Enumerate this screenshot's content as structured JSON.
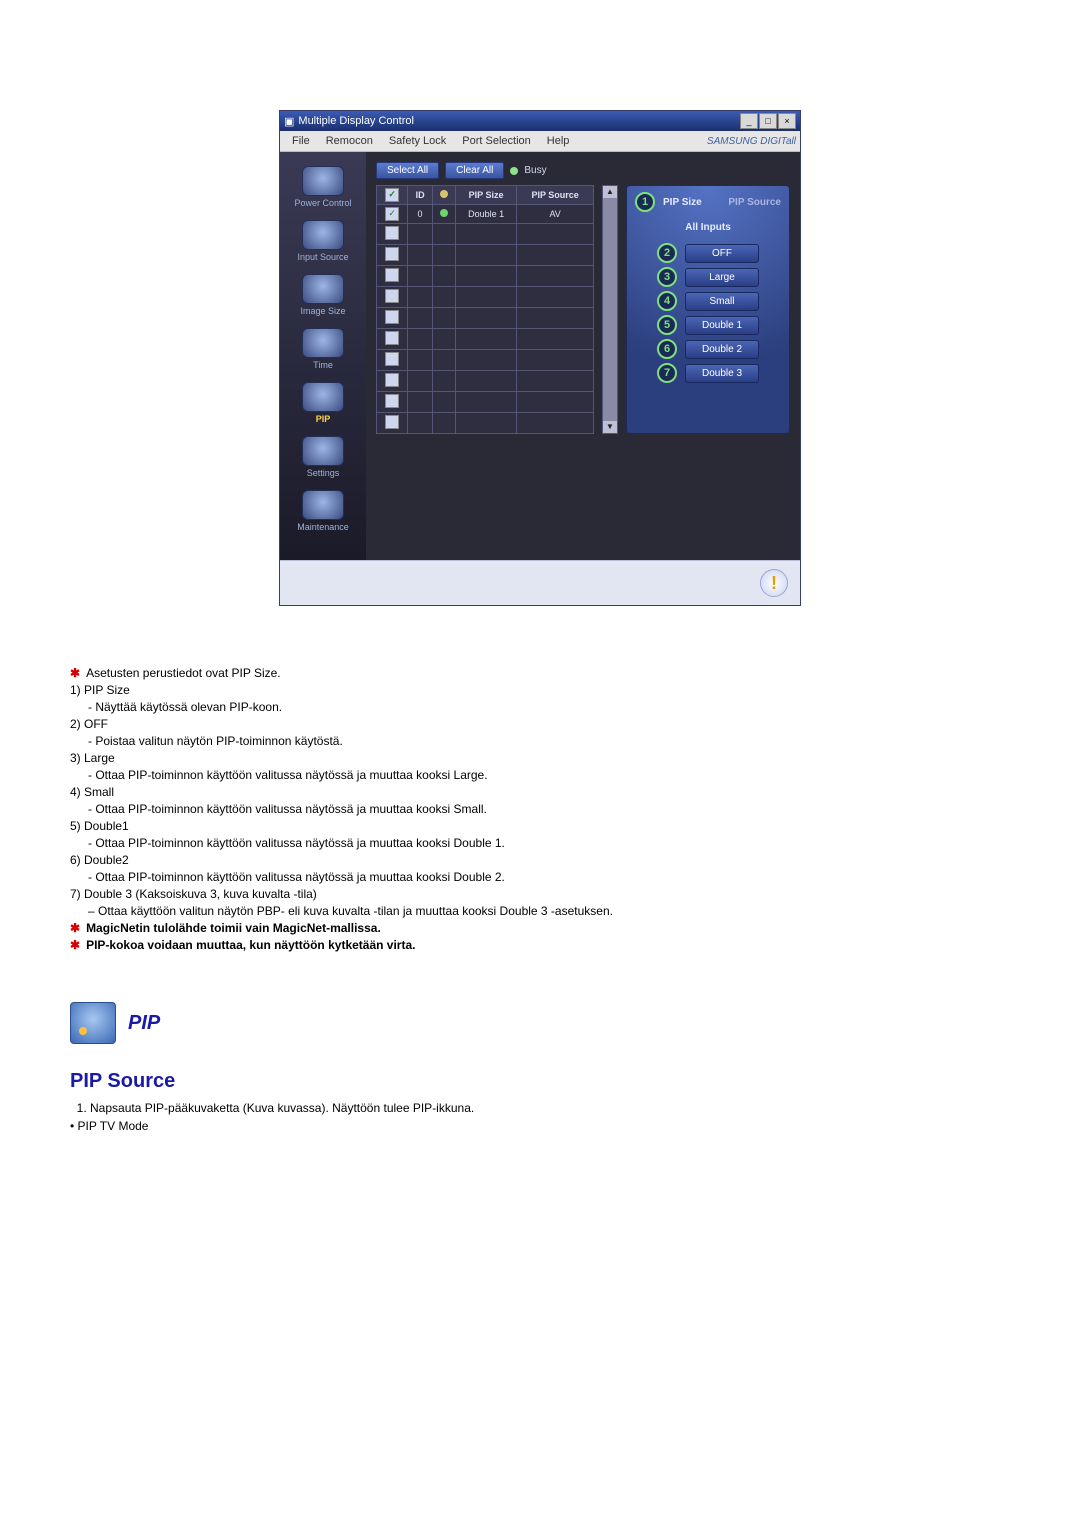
{
  "app": {
    "title": "Multiple Display Control",
    "brand": "SAMSUNG DIGITall",
    "menus": [
      "File",
      "Remocon",
      "Safety Lock",
      "Port Selection",
      "Help"
    ],
    "sys": {
      "min": "_",
      "max": "□",
      "close": "×"
    }
  },
  "sidebar": {
    "items": [
      {
        "label": "Power Control"
      },
      {
        "label": "Input Source"
      },
      {
        "label": "Image Size"
      },
      {
        "label": "Time"
      },
      {
        "label": "PIP"
      },
      {
        "label": "Settings"
      },
      {
        "label": "Maintenance"
      }
    ],
    "active_index": 4
  },
  "toolbar": {
    "select_all": "Select All",
    "clear_all": "Clear All",
    "busy": "Busy"
  },
  "table": {
    "headers": {
      "chk": "✓",
      "id": "ID",
      "stat": "",
      "size": "PIP Size",
      "source": "PIP Source"
    },
    "rows": [
      {
        "checked": true,
        "id": "0",
        "stat": "green",
        "size": "Double 1",
        "source": "AV"
      },
      {
        "checked": false,
        "id": "",
        "stat": "",
        "size": "",
        "source": ""
      },
      {
        "checked": false,
        "id": "",
        "stat": "",
        "size": "",
        "source": ""
      },
      {
        "checked": false,
        "id": "",
        "stat": "",
        "size": "",
        "source": ""
      },
      {
        "checked": false,
        "id": "",
        "stat": "",
        "size": "",
        "source": ""
      },
      {
        "checked": false,
        "id": "",
        "stat": "",
        "size": "",
        "source": ""
      },
      {
        "checked": false,
        "id": "",
        "stat": "",
        "size": "",
        "source": ""
      },
      {
        "checked": false,
        "id": "",
        "stat": "",
        "size": "",
        "source": ""
      },
      {
        "checked": false,
        "id": "",
        "stat": "",
        "size": "",
        "source": ""
      },
      {
        "checked": false,
        "id": "",
        "stat": "",
        "size": "",
        "source": ""
      },
      {
        "checked": false,
        "id": "",
        "stat": "",
        "size": "",
        "source": ""
      }
    ]
  },
  "right_panel": {
    "head_primary": "PIP Size",
    "head_secondary": "PIP Source",
    "all_inputs": "All Inputs",
    "options": [
      {
        "num": "2",
        "label": "OFF"
      },
      {
        "num": "3",
        "label": "Large"
      },
      {
        "num": "4",
        "label": "Small"
      },
      {
        "num": "5",
        "label": "Double 1"
      },
      {
        "num": "6",
        "label": "Double 2"
      },
      {
        "num": "7",
        "label": "Double 3"
      }
    ],
    "head_callout": "1"
  },
  "doc": {
    "intro_star": "Asetusten perustiedot ovat PIP Size.",
    "items": [
      {
        "head": "1)  PIP Size",
        "body": "- Näyttää käytössä olevan PIP-koon."
      },
      {
        "head": "2)  OFF",
        "body": "- Poistaa valitun näytön PIP-toiminnon käytöstä."
      },
      {
        "head": "3)  Large",
        "body": "- Ottaa PIP-toiminnon käyttöön valitussa näytössä ja muuttaa kooksi Large."
      },
      {
        "head": "4)  Small",
        "body": "- Ottaa PIP-toiminnon käyttöön valitussa näytössä ja muuttaa kooksi Small."
      },
      {
        "head": "5)  Double1",
        "body": "- Ottaa PIP-toiminnon käyttöön valitussa näytössä ja muuttaa kooksi Double 1."
      },
      {
        "head": "6)  Double2",
        "body": "- Ottaa PIP-toiminnon käyttöön valitussa näytössä ja muuttaa kooksi Double 2."
      },
      {
        "head": "7)  Double 3 (Kaksoiskuva 3, kuva kuvalta -tila)",
        "body": "– Ottaa käyttöön valitun näytön PBP- eli kuva kuvalta -tilan ja muuttaa kooksi Double 3 -asetuksen."
      }
    ],
    "notes": [
      "MagicNetin tulolähde toimii vain MagicNet-mallissa.",
      "PIP-kokoa voidaan muuttaa, kun näyttöön kytketään virta."
    ],
    "section_title": "PIP",
    "subheading": "PIP Source",
    "num_1": "Napsauta PIP-pääkuvaketta (Kuva kuvassa). Näyttöön tulee PIP-ikkuna.",
    "bullet": "PIP TV Mode"
  }
}
